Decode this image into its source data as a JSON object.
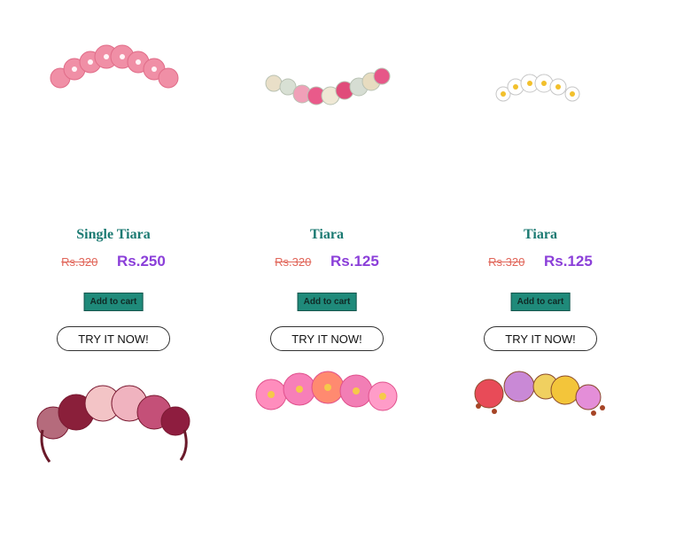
{
  "products": [
    {
      "title": "Single Tiara",
      "old_price": "Rs.320",
      "new_price": "Rs.250",
      "cart_label": "Add to cart",
      "try_label": "TRY IT NOW!"
    },
    {
      "title": "Tiara",
      "old_price": "Rs.320",
      "new_price": "Rs.125",
      "cart_label": "Add to cart",
      "try_label": "TRY IT NOW!"
    },
    {
      "title": "Tiara",
      "old_price": "Rs.320",
      "new_price": "Rs.125",
      "cart_label": "Add to cart",
      "try_label": "TRY IT NOW!"
    }
  ],
  "colors": {
    "title": "#1b7a72",
    "old_price": "#e1665a",
    "new_price": "#8b3fd9",
    "cart_button": "#1f8a7a"
  }
}
